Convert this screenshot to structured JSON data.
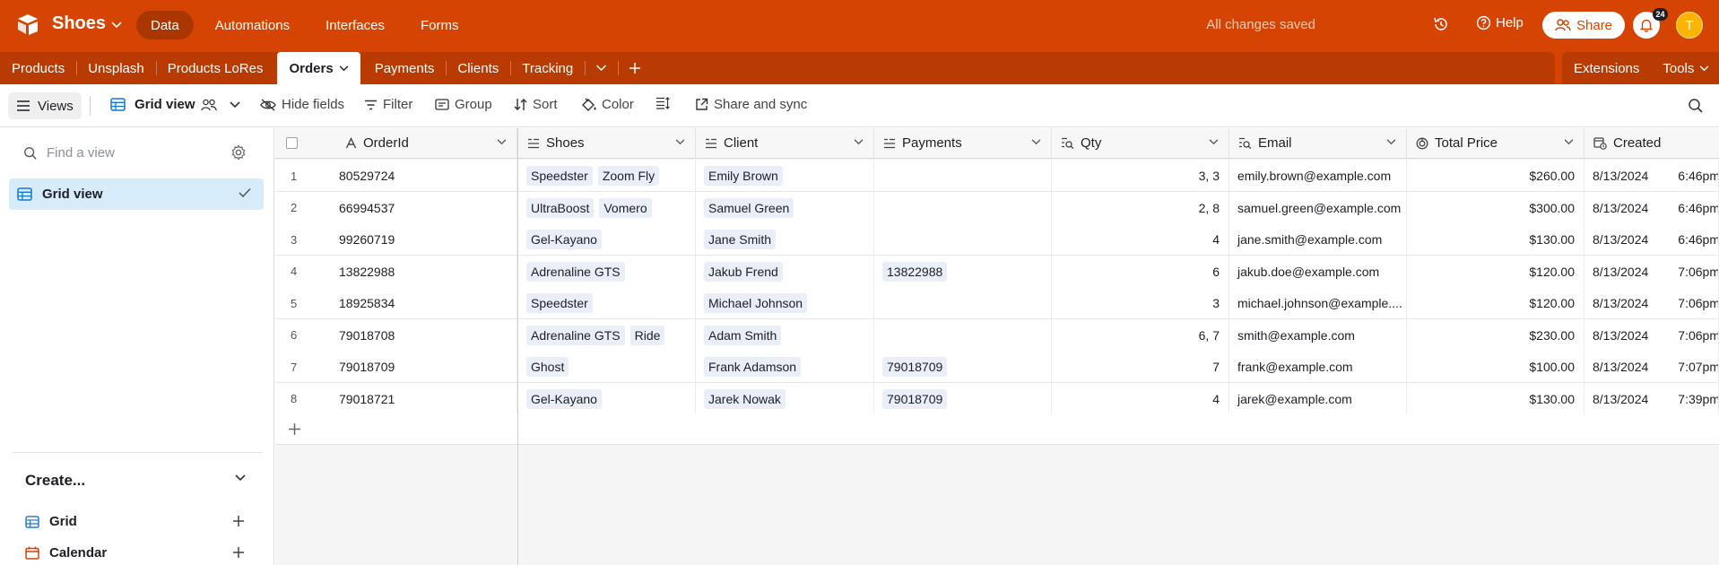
{
  "header": {
    "base_name": "Shoes",
    "nav": [
      "Data",
      "Automations",
      "Interfaces",
      "Forms"
    ],
    "status": "All changes saved",
    "help_label": "Help",
    "share_label": "Share",
    "notification_count": "24",
    "avatar_initial": "T",
    "color_brand": "#d54402"
  },
  "tabs": {
    "items": [
      "Products",
      "Unsplash",
      "Products LoRes",
      "Orders",
      "Payments",
      "Clients",
      "Tracking"
    ],
    "active": "Orders",
    "extensions_label": "Extensions",
    "tools_label": "Tools"
  },
  "viewbar": {
    "views_label": "Views",
    "view_name": "Grid view",
    "hide_fields": "Hide fields",
    "filter": "Filter",
    "group": "Group",
    "sort": "Sort",
    "color": "Color",
    "share_sync": "Share and sync"
  },
  "sidebar": {
    "find_placeholder": "Find a view",
    "active_view": "Grid view",
    "create_label": "Create...",
    "create_items": [
      "Grid",
      "Calendar"
    ]
  },
  "table": {
    "columns": [
      "OrderId",
      "Shoes",
      "Client",
      "Payments",
      "Qty",
      "Email",
      "Total Price",
      "Created"
    ],
    "rows": [
      {
        "n": "1",
        "order": "80529724",
        "shoes": [
          "Speedster",
          "Zoom Fly"
        ],
        "client": "Emily Brown",
        "payments": "",
        "qty": "3, 3",
        "email": "emily.brown@example.com",
        "price": "$260.00",
        "date": "8/13/2024",
        "time": "6:46pm"
      },
      {
        "n": "2",
        "order": "66994537",
        "shoes": [
          "UltraBoost",
          "Vomero"
        ],
        "client": "Samuel Green",
        "payments": "",
        "qty": "2, 8",
        "email": "samuel.green@example.com",
        "price": "$300.00",
        "date": "8/13/2024",
        "time": "6:46pm"
      },
      {
        "n": "3",
        "order": "99260719",
        "shoes": [
          "Gel-Kayano"
        ],
        "client": "Jane Smith",
        "payments": "",
        "qty": "4",
        "email": "jane.smith@example.com",
        "price": "$130.00",
        "date": "8/13/2024",
        "time": "6:46pm"
      },
      {
        "n": "4",
        "order": "13822988",
        "shoes": [
          "Adrenaline GTS"
        ],
        "client": "Jakub Frend",
        "payments": "13822988",
        "qty": "6",
        "email": "jakub.doe@example.com",
        "price": "$120.00",
        "date": "8/13/2024",
        "time": "7:06pm"
      },
      {
        "n": "5",
        "order": "18925834",
        "shoes": [
          "Speedster"
        ],
        "client": "Michael Johnson",
        "payments": "",
        "qty": "3",
        "email": "michael.johnson@example....",
        "price": "$120.00",
        "date": "8/13/2024",
        "time": "7:06pm"
      },
      {
        "n": "6",
        "order": "79018708",
        "shoes": [
          "Adrenaline GTS",
          "Ride"
        ],
        "client": "Adam Smith",
        "payments": "",
        "qty": "6, 7",
        "email": "smith@example.com",
        "price": "$230.00",
        "date": "8/13/2024",
        "time": "7:06pm"
      },
      {
        "n": "7",
        "order": "79018709",
        "shoes": [
          "Ghost"
        ],
        "client": "Frank Adamson",
        "payments": "79018709",
        "qty": "7",
        "email": "frank@example.com",
        "price": "$100.00",
        "date": "8/13/2024",
        "time": "7:07pm"
      },
      {
        "n": "8",
        "order": "79018721",
        "shoes": [
          "Gel-Kayano"
        ],
        "client": "Jarek Nowak",
        "payments": "79018709",
        "qty": "4",
        "email": "jarek@example.com",
        "price": "$130.00",
        "date": "8/13/2024",
        "time": "7:39pm"
      }
    ]
  }
}
